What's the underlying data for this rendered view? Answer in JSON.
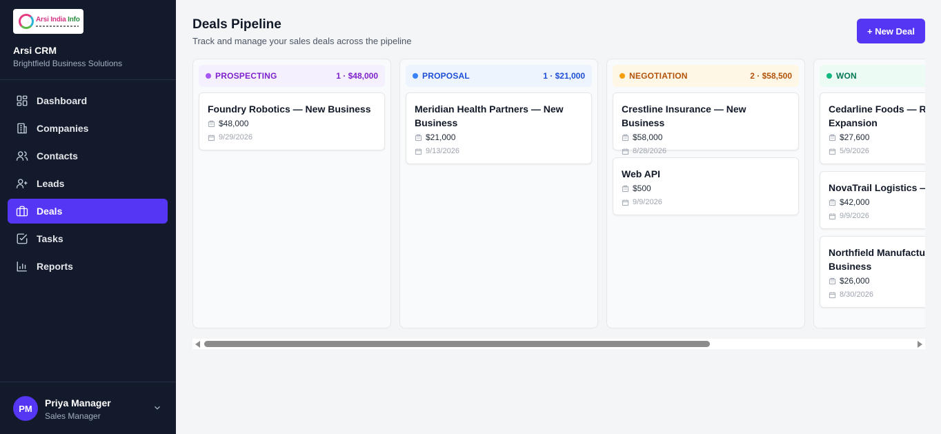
{
  "brand": {
    "logo_text_main": "Arsi India",
    "logo_text_accent": "Info",
    "name": "Arsi CRM",
    "subtitle": "Brightfield Business Solutions"
  },
  "nav": {
    "items": [
      {
        "label": "Dashboard",
        "icon": "dashboard-icon"
      },
      {
        "label": "Companies",
        "icon": "building-icon"
      },
      {
        "label": "Contacts",
        "icon": "users-icon"
      },
      {
        "label": "Leads",
        "icon": "user-plus-icon"
      },
      {
        "label": "Deals",
        "icon": "briefcase-icon",
        "active": true
      },
      {
        "label": "Tasks",
        "icon": "checkbox-icon"
      },
      {
        "label": "Reports",
        "icon": "bar-chart-icon"
      }
    ]
  },
  "user": {
    "initials": "PM",
    "name": "Priya Manager",
    "role": "Sales Manager"
  },
  "header": {
    "title": "Deals Pipeline",
    "subtitle": "Track and manage your sales deals across the pipeline",
    "new_deal_label": "+ New Deal"
  },
  "columns": [
    {
      "title": "PROSPECTING",
      "stat": "1 · $48,000",
      "dot_color": "#a855f7",
      "text_color": "#7e22ce",
      "bg_color": "#f5f0fe",
      "cards": [
        {
          "title": "Foundry Robotics — New Business",
          "amount": "$48,000",
          "date": "9/29/2026"
        }
      ]
    },
    {
      "title": "PROPOSAL",
      "stat": "1 · $21,000",
      "dot_color": "#3b82f6",
      "text_color": "#1d4ed8",
      "bg_color": "#eef4fe",
      "cards": [
        {
          "title": "Meridian Health Partners — New Business",
          "amount": "$21,000",
          "date": "9/13/2026"
        }
      ]
    },
    {
      "title": "NEGOTIATION",
      "stat": "2 · $58,500",
      "dot_color": "#f59e0b",
      "text_color": "#b45309",
      "bg_color": "#fef7e6",
      "cards": [
        {
          "title": "Crestline Insurance — New Business",
          "amount": "$58,000",
          "date": "8/28/2026"
        },
        {
          "title": "Web API",
          "amount": "$500",
          "date": "9/9/2026"
        }
      ]
    },
    {
      "title": "WON",
      "stat": "",
      "dot_color": "#10b981",
      "text_color": "#047857",
      "bg_color": "#ecfbf3",
      "cards": [
        {
          "title": "Cedarline Foods — Renewal Expansion",
          "amount": "$27,600",
          "date": "5/9/2026"
        },
        {
          "title": "NovaTrail Logistics — Expansion",
          "amount": "$42,000",
          "date": "9/9/2026"
        },
        {
          "title": "Northfield Manufacturing — Business",
          "amount": "$26,000",
          "date": "8/30/2026"
        }
      ]
    }
  ]
}
